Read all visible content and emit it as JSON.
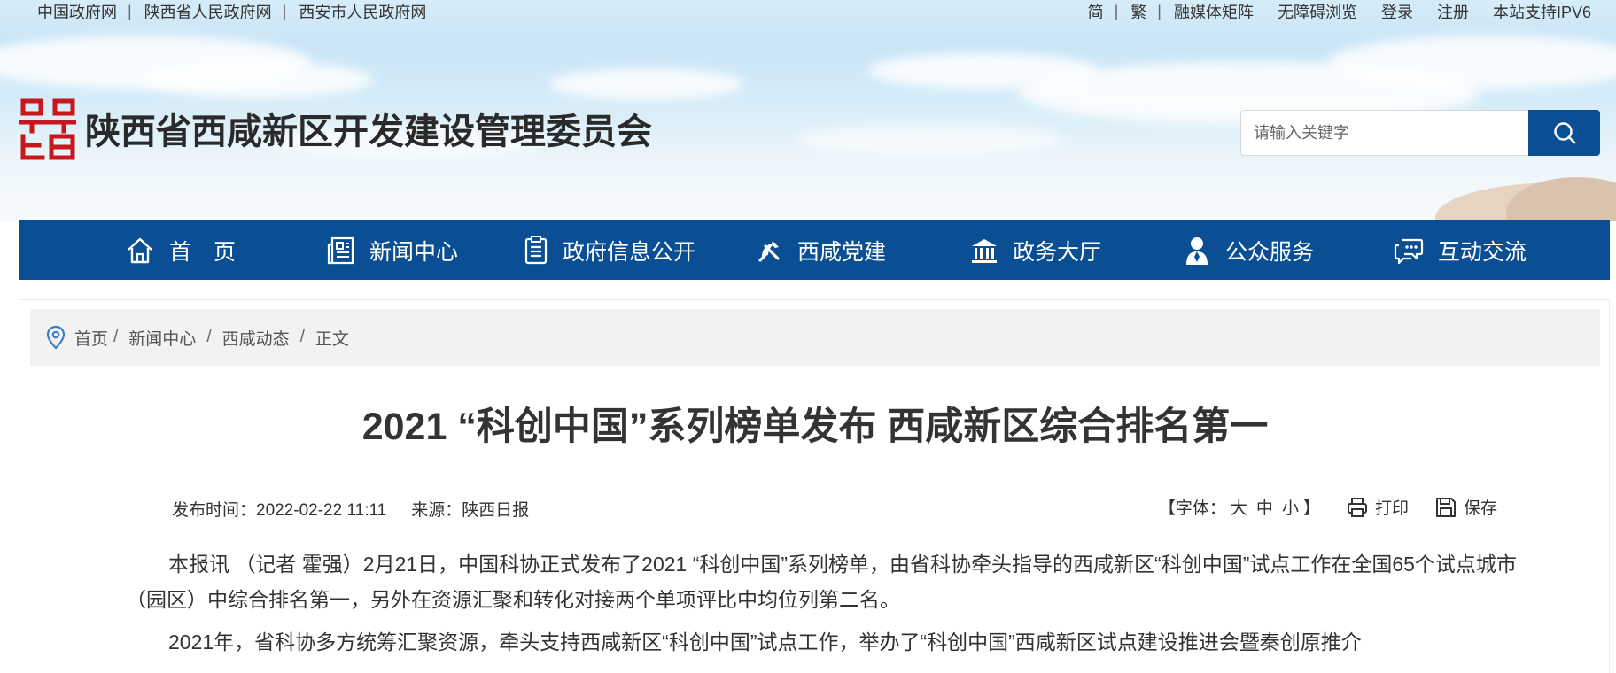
{
  "topbar": {
    "left_links": [
      "中国政府网",
      "陕西省人民政府网",
      "西安市人民政府网"
    ],
    "lang_simplified": "简",
    "lang_traditional": "繁",
    "right_links": [
      "融媒体矩阵",
      "无障碍浏览",
      "登录",
      "注册",
      "本站支持IPV6"
    ]
  },
  "header": {
    "site_title": "陕西省西咸新区开发建设管理委员会",
    "logo_icon": "xixian-seal-logo",
    "search_placeholder": "请输入关键字",
    "search_icon": "search-icon"
  },
  "nav": {
    "items": [
      {
        "label": "首　页",
        "icon": "home-icon"
      },
      {
        "label": "新闻中心",
        "icon": "newspaper-icon"
      },
      {
        "label": "政府信息公开",
        "icon": "document-list-icon"
      },
      {
        "label": "西咸党建",
        "icon": "party-emblem-icon"
      },
      {
        "label": "政务大厅",
        "icon": "government-building-icon"
      },
      {
        "label": "公众服务",
        "icon": "person-service-icon"
      },
      {
        "label": "互动交流",
        "icon": "chat-bubble-icon"
      }
    ]
  },
  "breadcrumb": {
    "icon": "location-pin-icon",
    "items": [
      "首页",
      "新闻中心",
      "西咸动态",
      "正文"
    ]
  },
  "article": {
    "title": "2021 “科创中国”系列榜单发布 西咸新区综合排名第一",
    "publish_time": "发布时间：2022-02-22 11:11",
    "source": "来源：陕西日报",
    "font_ctl_prefix": "【字体：",
    "font_large": "大",
    "font_medium": "中",
    "font_small": "小",
    "font_ctl_suffix": "】",
    "print_label": "打印",
    "save_label": "保存",
    "paragraphs": [
      "本报讯 （记者 霍强）2月21日，中国科协正式发布了2021 “科创中国”系列榜单，由省科协牵头指导的西咸新区“科创中国”试点工作在全国65个试点城市（园区）中综合排名第一，另外在资源汇聚和转化对接两个单项评比中均位列第二名。",
      "2021年，省科协多方统筹汇聚资源，牵头支持西咸新区“科创中国”试点工作，举办了“科创中国”西咸新区试点建设推进会暨秦创原推介"
    ]
  },
  "colors": {
    "nav_bg": "#0a4f94",
    "logo_red": "#c8161d",
    "page_text": "#333333"
  }
}
